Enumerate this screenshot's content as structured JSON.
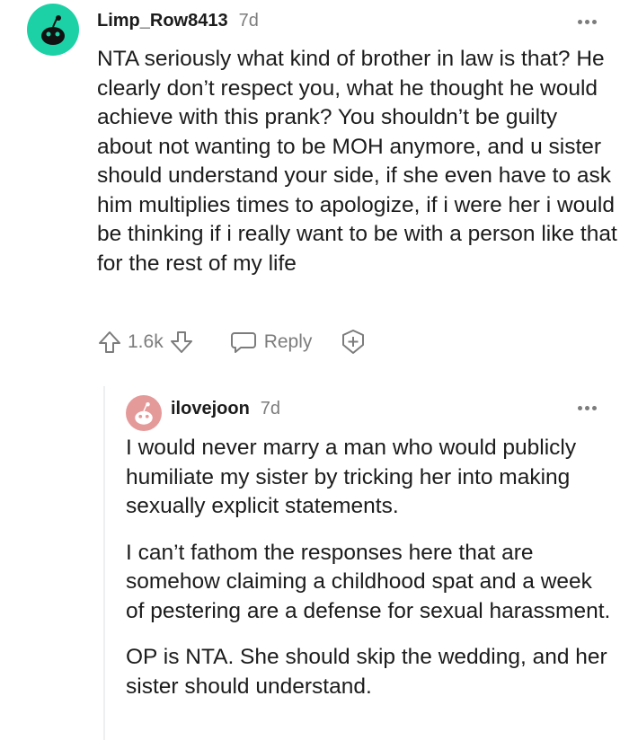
{
  "comments": [
    {
      "username": "Limp_Row8413",
      "age": "7d",
      "avatar_color": "#1bd1a5",
      "paragraphs": [
        "NTA seriously what kind of brother in law is that? He clearly don’t respect you, what he thought he would achieve with this prank? You shouldn’t be guilty about not wanting to be MOH anymore, and u sister should understand your side, if she even have to ask him multiplies times to apologize, if i were her i would be thinking if i really want to be with a person like that for the rest of my life"
      ],
      "score": "1.6k",
      "reply_label": "Reply"
    },
    {
      "username": "ilovejoon",
      "age": "7d",
      "avatar_color": "#e59a9a",
      "paragraphs": [
        "I would never marry a man who would publicly humiliate my sister by tricking her into making sexually explicit statements.",
        "I can’t fathom the responses here that are somehow claiming a childhood spat and a week of pestering are a defense for sexual harassment.",
        "OP is NTA. She should skip the wedding, and her sister should understand."
      ]
    }
  ],
  "icons": {
    "more": "more-options-icon",
    "upvote": "upvote-arrow-icon",
    "downvote": "downvote-arrow-icon",
    "reply": "reply-bubble-icon",
    "award": "award-plus-icon",
    "avatar": "snoo-avatar-icon"
  },
  "colors": {
    "meta_gray": "#7c7c7c",
    "text": "#1c1c1c"
  }
}
